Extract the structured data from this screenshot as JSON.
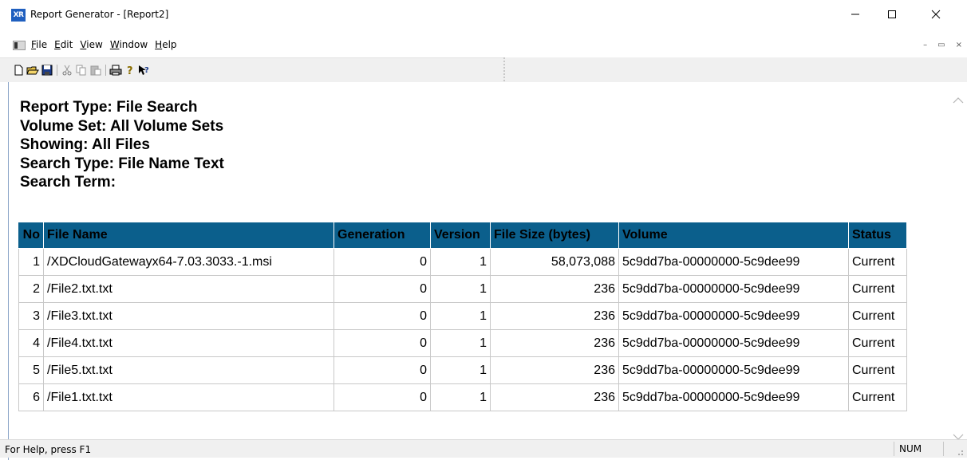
{
  "window": {
    "app_icon_text": "XR",
    "title": "Report Generator - [Report2]"
  },
  "menu": {
    "items": [
      {
        "first": "F",
        "rest": "ile"
      },
      {
        "first": "E",
        "rest": "dit"
      },
      {
        "first": "V",
        "rest": "iew"
      },
      {
        "first": "W",
        "rest": "indow"
      },
      {
        "first": "H",
        "rest": "elp"
      }
    ]
  },
  "toolbar": {
    "icons": [
      "new-icon",
      "open-icon",
      "save-icon",
      "cut-icon",
      "copy-icon",
      "paste-icon",
      "print-icon",
      "about-icon",
      "context-help-icon"
    ]
  },
  "report": {
    "type_line": "Report Type: File Search",
    "volume_set_line": "Volume Set: All Volume Sets",
    "showing_line": "Showing: All Files",
    "search_type_line": "Search Type: File Name Text",
    "search_term_line": "Search Term:"
  },
  "table": {
    "headers": [
      "No",
      "File Name",
      "Generation",
      "Version",
      "File Size (bytes)",
      "Volume",
      "Status"
    ],
    "rows": [
      [
        "1",
        "/XDCloudGatewayx64-7.03.3033.-1.msi",
        "0",
        "1",
        "58,073,088",
        "5c9dd7ba-00000000-5c9dee99",
        "Current"
      ],
      [
        "2",
        "/File2.txt.txt",
        "0",
        "1",
        "236",
        "5c9dd7ba-00000000-5c9dee99",
        "Current"
      ],
      [
        "3",
        "/File3.txt.txt",
        "0",
        "1",
        "236",
        "5c9dd7ba-00000000-5c9dee99",
        "Current"
      ],
      [
        "4",
        "/File4.txt.txt",
        "0",
        "1",
        "236",
        "5c9dd7ba-00000000-5c9dee99",
        "Current"
      ],
      [
        "5",
        "/File5.txt.txt",
        "0",
        "1",
        "236",
        "5c9dd7ba-00000000-5c9dee99",
        "Current"
      ],
      [
        "6",
        "/File1.txt.txt",
        "0",
        "1",
        "236",
        "5c9dd7ba-00000000-5c9dee99",
        "Current"
      ]
    ],
    "header_color": "#0b5f8c"
  },
  "status": {
    "help_text": "For Help, press F1",
    "num_indicator": "NUM"
  }
}
